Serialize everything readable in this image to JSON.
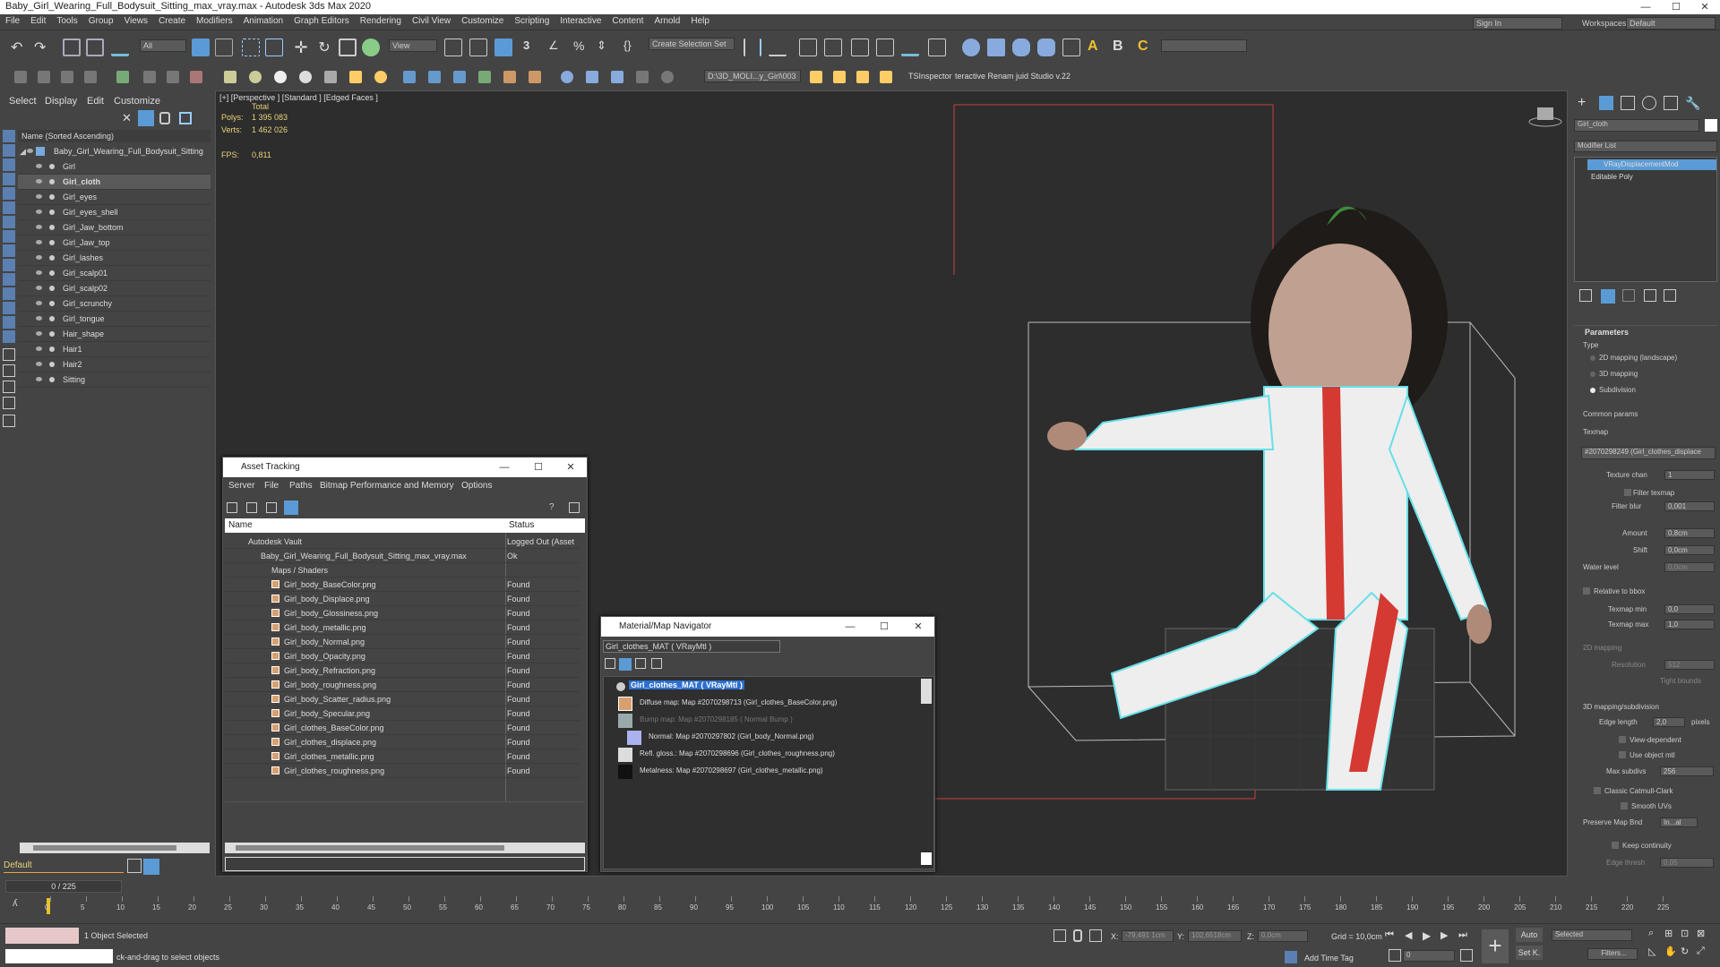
{
  "window": {
    "title": "Baby_Girl_Wearing_Full_Bodysuit_Sitting_max_vray.max - Autodesk 3ds Max 2020",
    "min": "—",
    "max": "☐",
    "close": "✕"
  },
  "menu": [
    "File",
    "Edit",
    "Tools",
    "Group",
    "Views",
    "Create",
    "Modifiers",
    "Animation",
    "Graph Editors",
    "Rendering",
    "Civil View",
    "Customize",
    "Scripting",
    "Interactive",
    "Content",
    "Arnold",
    "Help"
  ],
  "signin": "Sign In",
  "workspaces_label": "Workspaces:",
  "workspaces_value": "Default",
  "toolbar": {
    "filter": "All",
    "view": "View",
    "selection_set": "Create Selection Set",
    "project_path": "D:\\3D_MOLI...y_Girl\\003",
    "tsinspector": "TSInspector",
    "renamer": "teractive Renam juid Studio v.22"
  },
  "scene_explorer": {
    "tabs": [
      "Select",
      "Display",
      "Edit",
      "Customize"
    ],
    "header": "Name (Sorted Ascending)",
    "root": "Baby_Girl_Wearing_Full_Bodysuit_Sitting",
    "items": [
      "Girl",
      "Girl_cloth",
      "Girl_eyes",
      "Girl_eyes_shell",
      "Girl_Jaw_bottom",
      "Girl_Jaw_top",
      "Girl_lashes",
      "Girl_scalp01",
      "Girl_scalp02",
      "Girl_scrunchy",
      "Girl_tongue",
      "Hair_shape",
      "Hair1",
      "Hair2",
      "Sitting"
    ],
    "selected": "Girl_cloth",
    "layer": "Default"
  },
  "viewport": {
    "label": "[+] [Perspective ] [Standard ] [Edged Faces ]",
    "total": "Total",
    "polys_label": "Polys:",
    "polys": "1 395 083",
    "verts_label": "Verts:",
    "verts": "1 462 026",
    "fps_label": "FPS:",
    "fps": "0,811"
  },
  "asset_tracking": {
    "title": "Asset Tracking",
    "menu": [
      "Server",
      "File",
      "Paths",
      "Bitmap Performance and Memory",
      "Options"
    ],
    "col_name": "Name",
    "col_status": "Status",
    "vault": "Autodesk Vault",
    "vault_status": "Logged Out (Asset",
    "file": "Baby_Girl_Wearing_Full_Bodysuit_Sitting_max_vray.max",
    "file_status": "Ok",
    "maps": "Maps / Shaders",
    "assets": [
      {
        "name": "Girl_body_BaseColor.png",
        "status": "Found"
      },
      {
        "name": "Girl_body_Displace.png",
        "status": "Found"
      },
      {
        "name": "Girl_body_Glossiness.png",
        "status": "Found"
      },
      {
        "name": "Girl_body_metallic.png",
        "status": "Found"
      },
      {
        "name": "Girl_body_Normal.png",
        "status": "Found"
      },
      {
        "name": "Girl_body_Opacity.png",
        "status": "Found"
      },
      {
        "name": "Girl_body_Refraction.png",
        "status": "Found"
      },
      {
        "name": "Girl_body_roughness.png",
        "status": "Found"
      },
      {
        "name": "Girl_body_Scatter_radius.png",
        "status": "Found"
      },
      {
        "name": "Girl_body_Specular.png",
        "status": "Found"
      },
      {
        "name": "Girl_clothes_BaseColor.png",
        "status": "Found"
      },
      {
        "name": "Girl_clothes_displace.png",
        "status": "Found"
      },
      {
        "name": "Girl_clothes_metallic.png",
        "status": "Found"
      },
      {
        "name": "Girl_clothes_roughness.png",
        "status": "Found"
      }
    ]
  },
  "mat_nav": {
    "title": "Material/Map Navigator",
    "field": "Girl_clothes_MAT  ( VRayMtl )",
    "root": "Girl_clothes_MAT  ( VRayMtl )",
    "maps": [
      "Diffuse map: Map #2070298713 (Girl_clothes_BaseColor.png)",
      "Bump map: Map #2070298185  ( Normal Bump )",
      "Normal: Map #2070297802 (Girl_body_Normal.png)",
      "Refl. gloss.: Map #2070298696 (Girl_clothes_roughness.png)",
      "Metalness: Map #2070298697 (Girl_clothes_metallic.png)"
    ]
  },
  "command_panel": {
    "object_name": "Girl_cloth",
    "modifier_list": "Modifier List",
    "modifiers": [
      "VRayDisplacementMod",
      "Editable Poly"
    ],
    "parameters": "Parameters",
    "type_label": "Type",
    "types": [
      "2D mapping (landscape)",
      "3D mapping",
      "Subdivision"
    ],
    "common_params": "Common params",
    "texmap": "Texmap",
    "texmap_value": "#2070298249 (Girl_clothes_displace",
    "texture_chan_label": "Texture chan",
    "texture_chan": "1",
    "filter_texmap": "Filter texmap",
    "filter_blur_label": "Filter blur",
    "filter_blur": "0,001",
    "amount_label": "Amount",
    "amount": "0,8cm",
    "shift_label": "Shift",
    "shift": "0,0cm",
    "water_level_label": "Water level",
    "water_level": "0,0cm",
    "relative_bbox": "Relative to bbox",
    "texmap_min_label": "Texmap min",
    "texmap_min": "0,0",
    "texmap_max_label": "Texmap max",
    "texmap_max": "1,0",
    "mapping_2d": "2D mapping",
    "resolution_label": "Resolution",
    "resolution": "512",
    "tight_bounds": "Tight bounds",
    "mapping_3d": "3D mapping/subdivision",
    "edge_length_label": "Edge length",
    "edge_length": "2,0",
    "pixels": "pixels",
    "view_dependent": "View-dependent",
    "use_object_mtl": "Use object mtl",
    "max_subdivs_label": "Max subdivs",
    "max_subdivs": "256",
    "classic_catmull": "Classic Catmull-Clark",
    "smooth_uvs": "Smooth UVs",
    "preserve_map_label": "Preserve Map Bnd",
    "preserve_map": "In...al",
    "keep_continuity": "Keep continuity",
    "edge_thresh_label": "Edge thresh",
    "edge_thresh": "0,05"
  },
  "timeline": {
    "frame": "0 / 225",
    "ticks": [
      "0",
      "5",
      "10",
      "15",
      "20",
      "25",
      "30",
      "35",
      "40",
      "45",
      "50",
      "55",
      "60",
      "65",
      "70",
      "75",
      "80",
      "85",
      "90",
      "95",
      "100",
      "105",
      "110",
      "115",
      "120",
      "125",
      "130",
      "135",
      "140",
      "145",
      "150",
      "155",
      "160",
      "165",
      "170",
      "175",
      "180",
      "185",
      "190",
      "195",
      "200",
      "205",
      "210",
      "215",
      "220",
      "225"
    ]
  },
  "status": {
    "selected": "1 Object Selected",
    "hint": "ck-and-drag to select objects",
    "x_label": "X:",
    "x": "-79,491 1cm",
    "y_label": "Y:",
    "y": "102,6518cm",
    "z_label": "Z:",
    "z": "0,0cm",
    "grid": "Grid = 10,0cm",
    "add_time_tag": "Add Time Tag",
    "auto": "Auto",
    "selected_dd": "Selected",
    "set_k": "Set K.",
    "filters": "Filters...",
    "frame_field": "0"
  }
}
